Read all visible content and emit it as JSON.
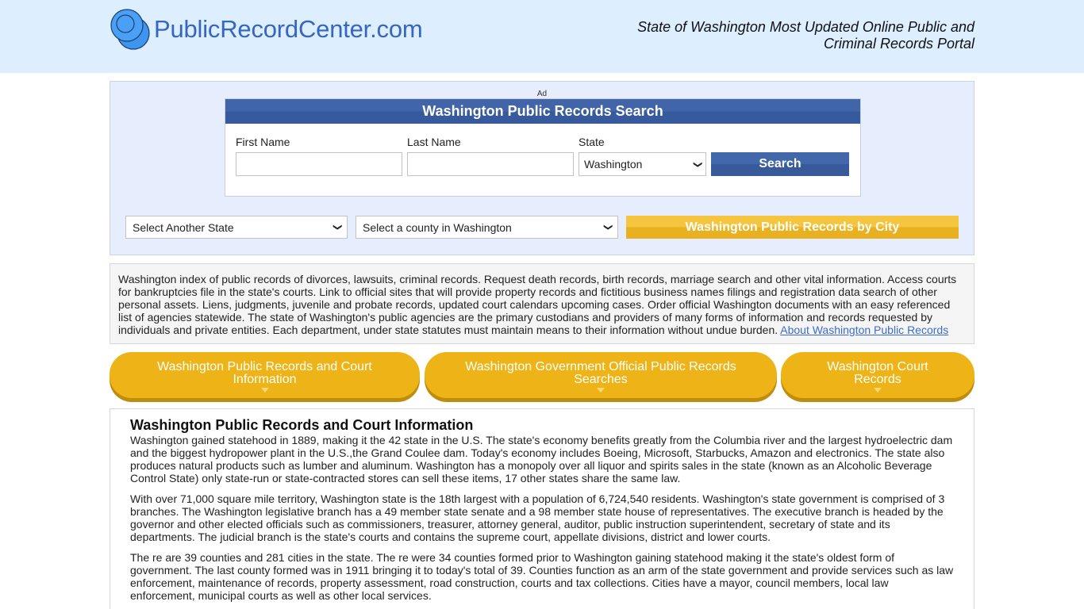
{
  "header": {
    "logo_text": "PublicRecordCenter.com",
    "tagline_line1": "State of Washington Most Updated Online Public and",
    "tagline_line2": "Criminal Records Portal"
  },
  "search": {
    "ad_label": "Ad",
    "title": "Washington Public Records Search",
    "first_name_label": "First Name",
    "first_name_value": "",
    "last_name_label": "Last Name",
    "last_name_value": "",
    "state_label": "State",
    "state_selected": "Washington",
    "search_button": "Search"
  },
  "nav": {
    "state_select": "Select Another State",
    "county_select": "Select a county in Washington",
    "city_button": "Washington Public Records by City"
  },
  "intro": {
    "text": "Washington index of public records of divorces, lawsuits, criminal records. Request death records, birth records, marriage search and other vital information. Access courts for bankruptcies file in the state's courts. Link to official sites that will provide property records and fictitious business names filings and registration data search of other personal assets. Liens, judgments, juvenile and probate records, updated court calendars upcoming cases. Order official Washington documents with an easy referenced list of agencies statewide. The state of Washington's public agencies are the primary custodians and providers of many forms of information and records requested by individuals and private entities. Each department, under state statutes must maintain means to their information without undue burden. ",
    "link": "About Washington Public Records"
  },
  "tabs": [
    {
      "label": "Washington Public Records and Court Information"
    },
    {
      "label": "Washington Government Official Public Records Searches"
    },
    {
      "label": "Washington Court Records"
    }
  ],
  "content": {
    "heading": "Washington Public Records and Court Information",
    "paragraphs": [
      "Washington gained statehood in 1889, making it the 42 state in the U.S. The state's economy benefits greatly from the Columbia river and the largest hydroelectric dam and the biggest hydropower plant in the U.S.,the Grand Coulee dam. Today's economy includes Boeing, Microsoft, Starbucks, Amazon and electronics. The state also produces natural products such as lumber and aluminum. Washington has a monopoly over all liquor and spirits sales in the state (known as an Alcoholic Beverage Control State) only state-run or state-contracted stores can sell these items, 17 other states share the same law.",
      "With over 71,000 square mile territory, Washington state is the 18th largest with a population of 6,724,540 residents. Washington's state government is comprised of 3 branches. The Washington legislative branch has a 49 member state senate and a 98 member state house of representatives. The executive branch is headed by the governor and other elected officials such as commissioners, treasurer, attorney general, auditor, public instruction superintendent, secretary of state and its departments. The judicial branch is the state's courts and contains the supreme court, appellate divisions, district and lower courts.",
      "The re are 39 counties and 281 cities in the state. The re were 34 counties formed prior to Washington gaining statehood making it the state's oldest form of government. The last county formed was in 1911 bringing it to today's total of 39. Counties function as an arm of the state government and provide services such as law enforcement, maintenance of records, property assessment, road construction, courts and tax collections. Cities have a mayor, council members, local law enforcement, municipal courts as well as other local services."
    ]
  },
  "colors": {
    "header_bg": "#ddeefe",
    "brand_blue": "#3766c0",
    "search_blue": "#4165a8",
    "gold": "#eeb417",
    "link": "#3b6ccf"
  }
}
